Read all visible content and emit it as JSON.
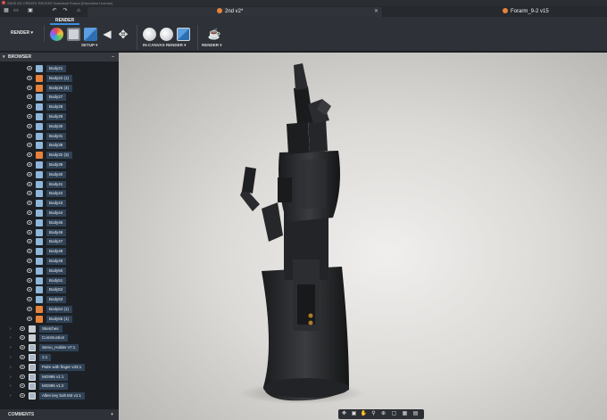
{
  "titlebar": {
    "text": "SAVE AS   CREATE   RECENT   Autodesk Fusion (Education License)"
  },
  "quick_icons": [
    "grid-icon",
    "file-icon",
    "save-icon",
    "undo-icon",
    "redo-icon",
    "home-icon"
  ],
  "tabs": [
    {
      "label": "2nd v2*",
      "active": true
    },
    {
      "label": "Forarm_9-2 v15",
      "active": false
    }
  ],
  "ribbon": {
    "workspace_label": "RENDER",
    "workspace_tab": "RENDER",
    "groups": {
      "setup": "SETUP",
      "in_canvas": "IN-CANVAS RENDER",
      "render": "RENDER"
    }
  },
  "browser": {
    "title": "BROWSER",
    "collapse_glyph": "–",
    "arrow_glyph": "▾",
    "items": [
      {
        "label": "Body21",
        "type": "body"
      },
      {
        "label": "Body22 (1)",
        "type": "body-orange"
      },
      {
        "label": "Body26 (4)",
        "type": "body-orange"
      },
      {
        "label": "Body27",
        "type": "body"
      },
      {
        "label": "Body28",
        "type": "body"
      },
      {
        "label": "Body29",
        "type": "body"
      },
      {
        "label": "Body30",
        "type": "body"
      },
      {
        "label": "Body31",
        "type": "body"
      },
      {
        "label": "Body38",
        "type": "body"
      },
      {
        "label": "Body32 (3)",
        "type": "body-orange"
      },
      {
        "label": "Body39",
        "type": "body"
      },
      {
        "label": "Body40",
        "type": "body"
      },
      {
        "label": "Body41",
        "type": "body"
      },
      {
        "label": "Body42",
        "type": "body"
      },
      {
        "label": "Body43",
        "type": "body"
      },
      {
        "label": "Body44",
        "type": "body"
      },
      {
        "label": "Body45",
        "type": "body"
      },
      {
        "label": "Body46",
        "type": "body"
      },
      {
        "label": "Body47",
        "type": "body"
      },
      {
        "label": "Body48",
        "type": "body"
      },
      {
        "label": "Body49",
        "type": "body"
      },
      {
        "label": "Body50",
        "type": "body"
      },
      {
        "label": "Body51",
        "type": "body"
      },
      {
        "label": "Body52",
        "type": "body"
      },
      {
        "label": "Body53",
        "type": "body"
      },
      {
        "label": "Body54 (1)",
        "type": "body-orange"
      },
      {
        "label": "Body55 (1)",
        "type": "body-orange"
      },
      {
        "label": "Sketches",
        "type": "folder"
      },
      {
        "label": "Construction",
        "type": "folder"
      },
      {
        "label": "Servo_Holder v7:1",
        "type": "component"
      },
      {
        "label": "1:1",
        "type": "component"
      },
      {
        "label": "Palm with finger v33:1",
        "type": "component"
      },
      {
        "label": "MG995 v1:1",
        "type": "component"
      },
      {
        "label": "MG995 v1:2",
        "type": "component"
      },
      {
        "label": "Allen key bolt M3 v1:1",
        "type": "component"
      }
    ]
  },
  "comments": {
    "label": "COMMENTS",
    "add_glyph": "+"
  },
  "navbar_icons": [
    "orbit-icon",
    "look-at-icon",
    "pan-icon",
    "zoom-icon",
    "zoom-window-icon",
    "display-settings-icon",
    "grid-settings-icon",
    "viewports-icon"
  ],
  "colors": {
    "accent": "#3b8ee0",
    "selection": "#2f4257",
    "orange": "#e8823a",
    "body_blue": "#8fb6da"
  }
}
